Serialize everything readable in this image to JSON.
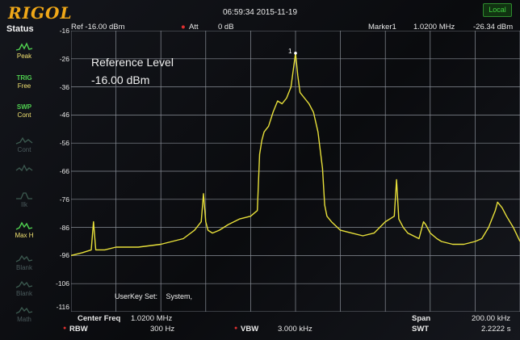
{
  "brand": "RIGOL",
  "datetime": "06:59:34 2015-11-19",
  "local_badge": "Local",
  "sidebar": {
    "title": "Status",
    "items": [
      {
        "id": "peak",
        "top": "",
        "label": "Peak",
        "icon": "peak-trace-icon",
        "state": "active"
      },
      {
        "id": "trig",
        "top": "TRIG",
        "label": "Free",
        "icon": "",
        "state": "head"
      },
      {
        "id": "swp",
        "top": "SWP",
        "label": "Cont",
        "icon": "",
        "state": "head"
      },
      {
        "id": "cont2",
        "top": "",
        "label": "Cont",
        "icon": "detector-icon",
        "state": "dim"
      },
      {
        "id": "blank1",
        "top": "",
        "label": "",
        "icon": "wave-icon",
        "state": "dim"
      },
      {
        "id": "ilk",
        "top": "",
        "label": "Ilk",
        "icon": "filter-icon",
        "state": "dim"
      },
      {
        "id": "maxh",
        "top": "",
        "label": "Max H",
        "icon": "max-hold-icon",
        "state": "active"
      },
      {
        "id": "blank2",
        "top": "",
        "label": "Blank",
        "icon": "blank-trace-icon",
        "state": "dim"
      },
      {
        "id": "blank3",
        "top": "",
        "label": "Blank",
        "icon": "blank-trace-icon",
        "state": "dim"
      },
      {
        "id": "math",
        "top": "",
        "label": "Math",
        "icon": "math-trace-icon",
        "state": "dim"
      }
    ]
  },
  "header": {
    "ref": "Ref -16.00 dBm",
    "att_label": "Att",
    "att_value": "0 dB",
    "marker_label": "Marker1",
    "marker_freq": "1.0200 MHz",
    "marker_amp": "-26.34 dBm"
  },
  "annotation": {
    "line1": "Reference Level",
    "line2": "-16.00 dBm"
  },
  "userkey": {
    "label": "UserKey Set:",
    "value": "System,"
  },
  "marker_number": "1",
  "bottom": {
    "center_freq_label": "Center Freq",
    "center_freq_value": "1.0200 MHz",
    "span_label": "Span",
    "span_value": "200.00 kHz",
    "rbw_label": "RBW",
    "rbw_value": "300 Hz",
    "vbw_label": "VBW",
    "vbw_value": "3.000 kHz",
    "swt_label": "SWT",
    "swt_value": "2.2222 s"
  },
  "colors": {
    "trace": "#e8e03a",
    "grid": "#8a8f98",
    "accent": "#f0a818"
  },
  "chart_data": {
    "type": "line",
    "xlabel": "",
    "ylabel": "",
    "xlim": [
      0.92,
      1.12
    ],
    "ylim": [
      -116,
      -16
    ],
    "y_ticks": [
      "-16",
      "-26",
      "-36",
      "-46",
      "-56",
      "-66",
      "-76",
      "-86",
      "-96",
      "-106",
      "-116"
    ],
    "grid": true,
    "series": [
      {
        "x": [
          0.92,
          0.925,
          0.929,
          0.93,
          0.931,
          0.935,
          0.94,
          0.95,
          0.96,
          0.965,
          0.97,
          0.975,
          0.978,
          0.979,
          0.98,
          0.981,
          0.983,
          0.986,
          0.99,
          0.995,
          1.0,
          1.003,
          1.004,
          1.005,
          1.006,
          1.008,
          1.01,
          1.012,
          1.014,
          1.016,
          1.018,
          1.019,
          1.02,
          1.021,
          1.022,
          1.024,
          1.026,
          1.028,
          1.03,
          1.032,
          1.033,
          1.034,
          1.036,
          1.04,
          1.045,
          1.05,
          1.055,
          1.06,
          1.064,
          1.065,
          1.066,
          1.068,
          1.07,
          1.075,
          1.077,
          1.078,
          1.08,
          1.083,
          1.085,
          1.09,
          1.095,
          1.1,
          1.103,
          1.106,
          1.108,
          1.109,
          1.11,
          1.112,
          1.114,
          1.117,
          1.12
        ],
        "y": [
          -96,
          -95,
          -94,
          -84,
          -94,
          -94,
          -93,
          -93,
          -92,
          -91,
          -90,
          -87,
          -84,
          -74,
          -84,
          -87,
          -88,
          -87,
          -85,
          -83,
          -82,
          -80,
          -60,
          -55,
          -52,
          -50,
          -45,
          -41,
          -42,
          -40,
          -36,
          -30,
          -24,
          -32,
          -38,
          -40,
          -42,
          -45,
          -52,
          -65,
          -78,
          -82,
          -84,
          -87,
          -88,
          -89,
          -88,
          -84,
          -82,
          -69,
          -83,
          -86,
          -88,
          -90,
          -84,
          -85,
          -88,
          -90,
          -91,
          -92,
          -92,
          -91,
          -90,
          -86,
          -82,
          -80,
          -77,
          -79,
          -82,
          -86,
          -91
        ]
      }
    ]
  }
}
